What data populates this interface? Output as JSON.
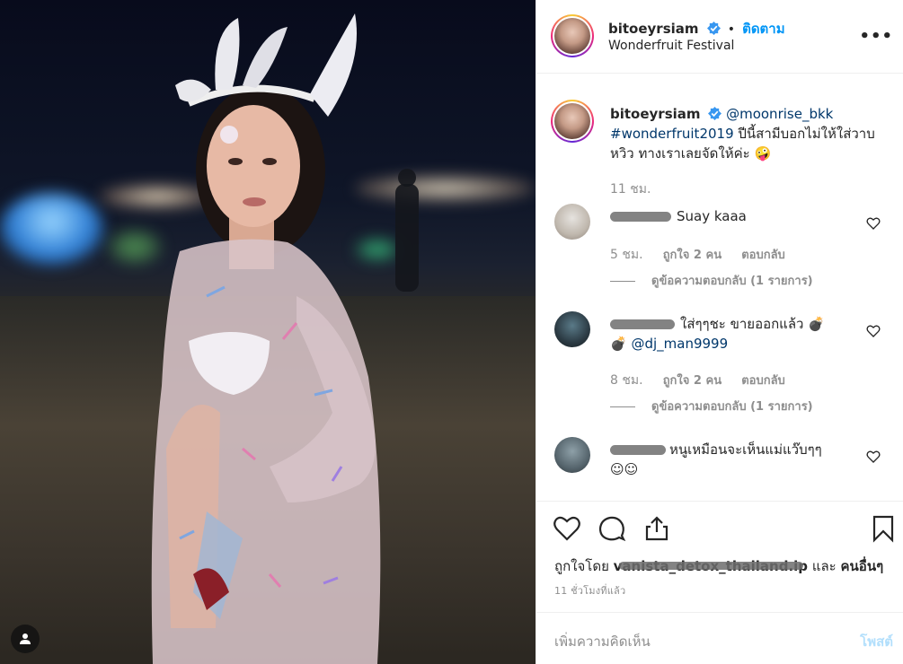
{
  "post": {
    "username": "bitoeyrsiam",
    "follow_label": "ติดตาม",
    "dot": "•",
    "location": "Wonderfruit Festival",
    "more_label": "•••"
  },
  "caption": {
    "username": "bitoeyrsiam",
    "mention": "@moonrise_bkk",
    "hashtag": "#wonderfruit2019",
    "text": " ปีนี้สามีบอกไม่ให้ใส่วาบหวิว ทางเราเลยจัดให้ค่ะ 🤪",
    "time": "11 ชม."
  },
  "comments": [
    {
      "text": "Suay kaaa",
      "time": "5 ชม.",
      "likes": "ถูกใจ 2 คน",
      "reply_label": "ตอบกลับ",
      "view_replies": "ดูข้อความตอบกลับ (1 รายการ)"
    },
    {
      "text": "ใส่ๆๆชะ ขายออกแล้ว 💣",
      "text2_icon": "💣",
      "mention": "@dj_man9999",
      "time": "8 ชม.",
      "likes": "ถูกใจ 2 คน",
      "reply_label": "ตอบกลับ",
      "view_replies": "ดูข้อความตอบกลับ (1 รายการ)"
    },
    {
      "text": "หนูเหมือนจะเห็นแม่แว๊บๆๆ",
      "text2": "☺☺"
    }
  ],
  "actions": {
    "liked_by_prefix": "ถูกใจโดย",
    "liked_by_user": "vanista_detox_thailand.ip",
    "liked_by_and": "และ",
    "liked_by_others": "คนอื่นๆ",
    "posted_time": "11 ชั่วโมงที่แล้ว"
  },
  "add_comment": {
    "placeholder": "เพิ่มความคิดเห็น",
    "post_label": "โพสต์"
  },
  "icons": {
    "verified": "verified-badge-icon",
    "heart": "heart-icon",
    "comment": "comment-icon",
    "share": "share-icon",
    "save": "bookmark-icon",
    "user_tag": "user-tag-icon",
    "more": "more-options-icon"
  },
  "colors": {
    "link": "#00376b",
    "follow": "#0095f6",
    "muted": "#8e8e8e",
    "post_disabled": "#b2dffc"
  }
}
